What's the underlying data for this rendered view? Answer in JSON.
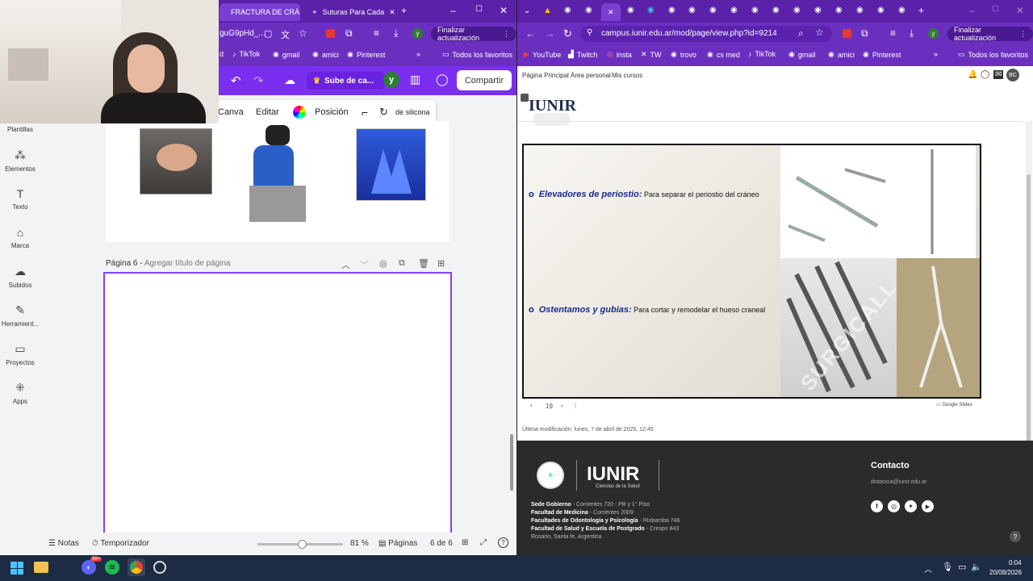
{
  "left_window": {
    "tabs": [
      {
        "label": "FRACTURA DE CRÁ"
      },
      {
        "label": "Suturas Para Cada"
      }
    ],
    "address": "guG9pHd_...",
    "update_button": "Finalizar actualización",
    "bookmarks": [
      "d",
      "TikTok",
      "gmail",
      "amici",
      "Pinterest"
    ],
    "all_bookmarks": "Todos los favoritos"
  },
  "canva": {
    "upload_button": "Sube de ca...",
    "avatar_letter": "y",
    "share_button": "Compartir",
    "toolbar": {
      "canva": "Canva",
      "edit": "Editar",
      "position": "Posición",
      "silicone": "de silicona"
    },
    "sidebar": [
      {
        "label": "Plantillas",
        "icon": "templates-icon"
      },
      {
        "label": "Elementos",
        "icon": "elements-icon"
      },
      {
        "label": "Texto",
        "icon": "text-icon"
      },
      {
        "label": "Marca",
        "icon": "brand-icon"
      },
      {
        "label": "Subidos",
        "icon": "uploads-icon"
      },
      {
        "label": "Herramient...",
        "icon": "tools-icon"
      },
      {
        "label": "Proyectos",
        "icon": "projects-icon"
      },
      {
        "label": "Apps",
        "icon": "apps-icon"
      }
    ],
    "page6_label": "Página 6 -",
    "page6_title_placeholder": "Agregar título de página",
    "bottom": {
      "notes": "Notas",
      "timer": "Temporizador",
      "zoom": "81 %",
      "pages": "Páginas",
      "page_count": "6 de 6"
    }
  },
  "right_window": {
    "address": "campus.iunir.edu.ar/mod/page/view.php?id=9214",
    "update_button": "Finalizar actualización",
    "bookmarks": [
      "YouTube",
      "Twitch",
      "insta",
      "TW",
      "trovo",
      "cs med",
      "TikTok",
      "gmail",
      "amici",
      "Pinterest"
    ],
    "all_bookmarks": "Todos los favoritos",
    "nav": [
      "Página Principal",
      "Área personal",
      "Mis cursos"
    ],
    "avatar": "BC",
    "logo": "IUNIR",
    "slide": {
      "item1_title": "Elevadores de periostio:",
      "item1_text": "Para separar el periostio del cráneo",
      "item2_title": "Ostentamos y gubias:",
      "item2_text": "Para cortar y remodelar el hueso craneal",
      "watermark": "SURGICALL",
      "slide_number": "19",
      "provider": "Google Slides"
    },
    "last_modified": "Última modificación: lunes, 7 de abril de 2025, 12:45",
    "footer": {
      "logo": "IUNIR",
      "logo_sub": "Ciencias de la Salud",
      "contact_title": "Contacto",
      "email": "distancia@iunir.edu.ar",
      "lines": [
        {
          "label": "Sede Gobierno",
          "value": "- Corrientes 720 - PB y 1° Piso"
        },
        {
          "label": "Facultad de Medicina",
          "value": "- Corrientes 2009"
        },
        {
          "label": "Facultades de Odontología y Psicología",
          "value": "- Riobamba 746"
        },
        {
          "label": "Facultad de Salud y Escuela de Postgrado",
          "value": "- Crespo 843"
        },
        {
          "label": "Rosario, Santa fe, Argentina",
          "value": ""
        }
      ]
    }
  },
  "taskbar": {
    "time": "0:04",
    "date": "20/08/2026",
    "badge": "99+"
  },
  "colors": {
    "browser": "#6b2fc0",
    "canva_purple": "#7a2ff0",
    "footer": "#2b2b2b"
  }
}
